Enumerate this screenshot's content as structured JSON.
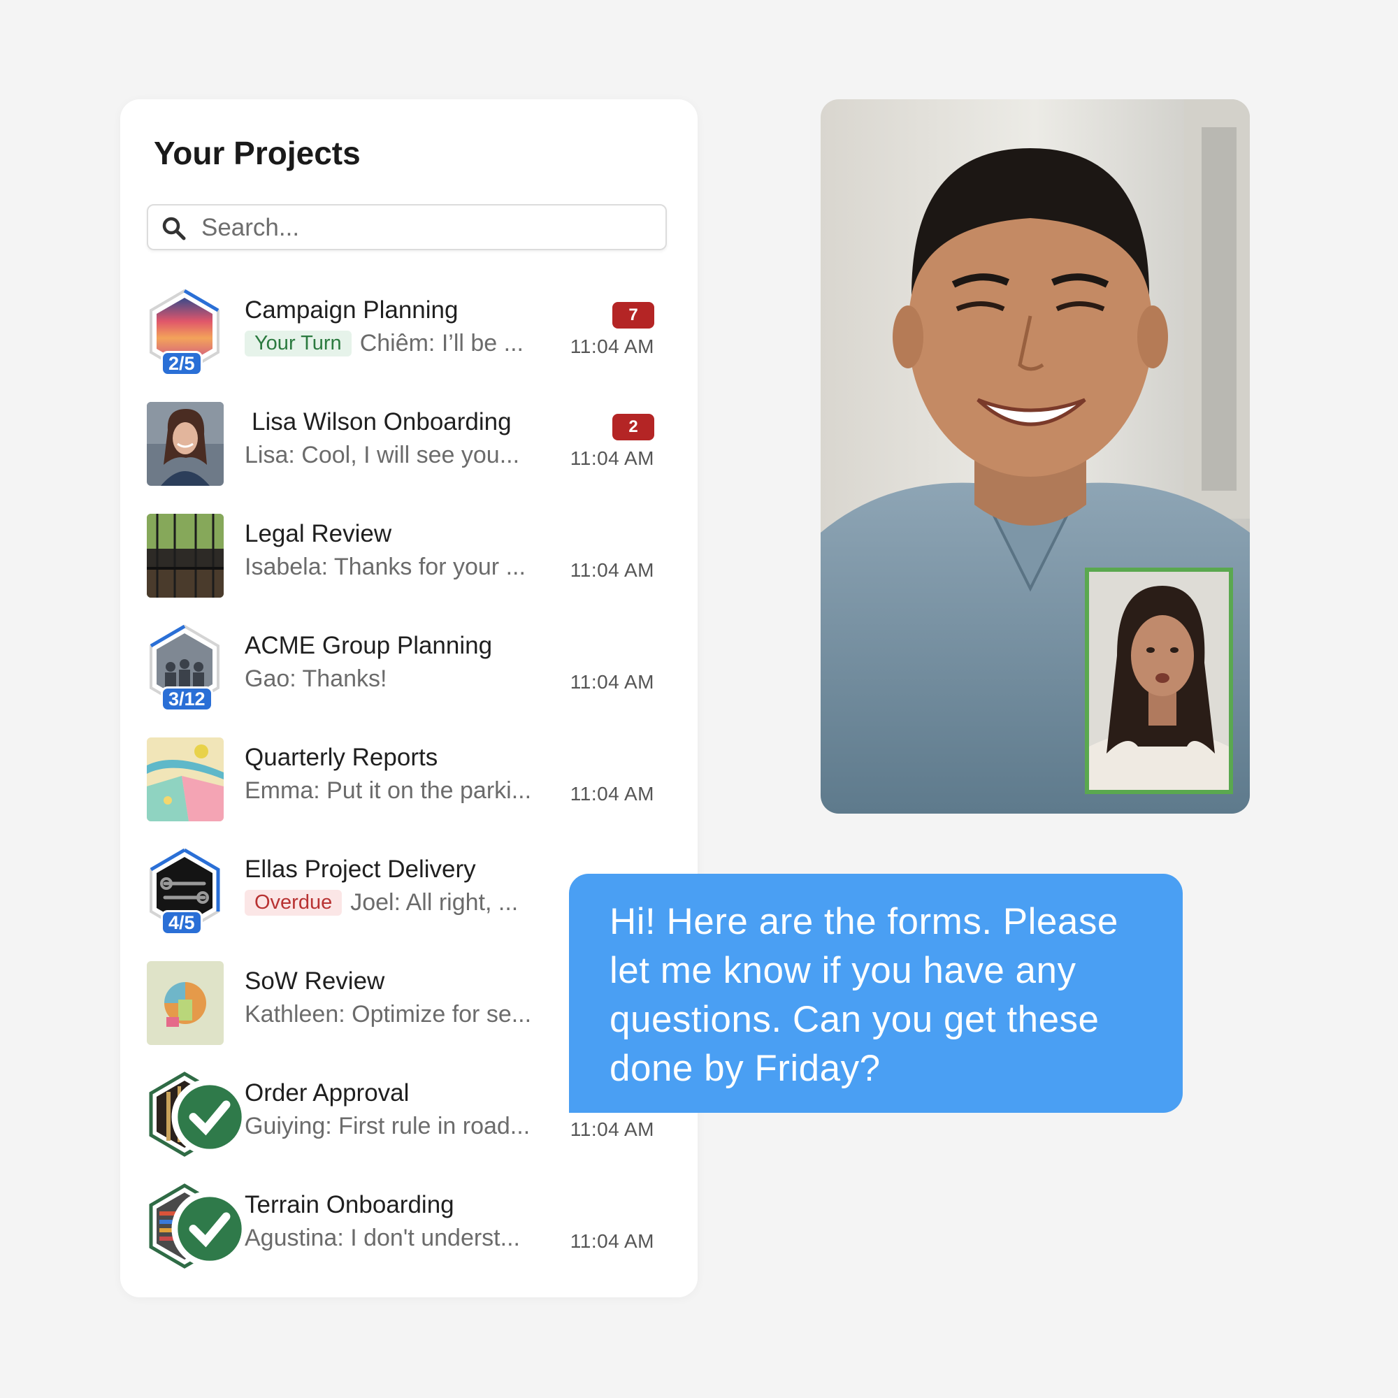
{
  "panel": {
    "title": "Your Projects",
    "search_placeholder": "Search..."
  },
  "projects": [
    {
      "title": "Campaign Planning",
      "tag": "Your Turn",
      "preview": "Chiêm: I’ll be ...",
      "time": "11:04 AM",
      "unread": "7",
      "progress": "2/5"
    },
    {
      "title": "Lisa Wilson Onboarding",
      "preview": "Lisa: Cool, I will see you...",
      "time": "11:04 AM",
      "unread": "2"
    },
    {
      "title": "Legal Review",
      "preview": "Isabela: Thanks for your ...",
      "time": "11:04 AM"
    },
    {
      "title": "ACME Group Planning",
      "preview": "Gao: Thanks!",
      "time": "11:04 AM",
      "progress": "3/12"
    },
    {
      "title": "Quarterly Reports",
      "preview": "Emma: Put it on the parki...",
      "time": "11:04 AM"
    },
    {
      "title": "Ellas Project Delivery",
      "tag": "Overdue",
      "preview": "Joel: All right, ...",
      "progress": "4/5"
    },
    {
      "title": "SoW Review",
      "preview": "Kathleen: Optimize for se..."
    },
    {
      "title": "Order Approval",
      "preview": "Guiying: First rule in road...",
      "time": "11:04 AM"
    },
    {
      "title": "Terrain Onboarding",
      "preview": "Agustina: I don't underst...",
      "time": "11:04 AM"
    }
  ],
  "chat": {
    "message": "Hi! Here are the forms. Please let me know if you have any questions. Can you get these done by Friday?"
  },
  "colors": {
    "accent_blue": "#2a6fd6",
    "bubble_blue": "#4a9ff3",
    "unread_red": "#b42525",
    "pip_border_green": "#5aa84f"
  }
}
